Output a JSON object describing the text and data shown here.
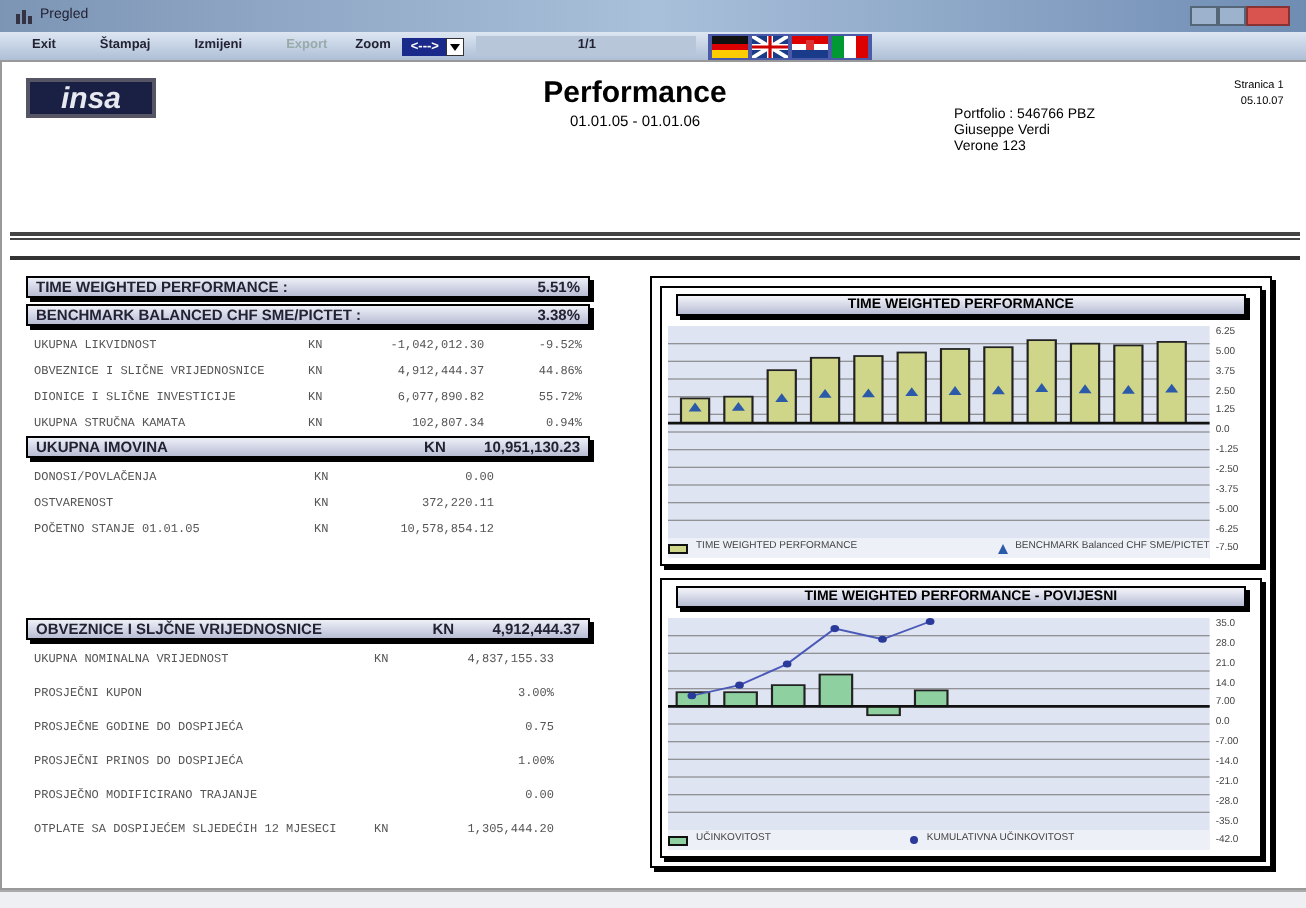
{
  "window": {
    "title": "Pregled"
  },
  "toolbar": {
    "buttons": [
      {
        "label": "Exit",
        "disabled": false
      },
      {
        "label": "Štampaj",
        "disabled": false
      },
      {
        "label": "Izmijeni",
        "disabled": false
      },
      {
        "label": "Export",
        "disabled": true
      }
    ],
    "zoom_label": "Zoom",
    "zoom_value": "<--->",
    "page": "1/1",
    "flags": [
      {
        "kind": "de"
      },
      {
        "kind": "gb"
      },
      {
        "kind": "hr"
      },
      {
        "kind": "it"
      }
    ]
  },
  "header": {
    "logo": "insa",
    "title": "Performance",
    "period": "01.01.05 - 01.01.06",
    "portfolio": [
      "Portfolio : 546766 PBZ",
      "Giuseppe Verdi",
      "Verone 123"
    ],
    "page": "Stranica 1",
    "date": "05.10.07"
  },
  "summary": [
    {
      "label": "TIME WEIGHTED PERFORMANCE :",
      "value": "5.51%"
    },
    {
      "label": "BENCHMARK BALANCED CHF SME/PICTET :",
      "value": "3.38%"
    }
  ],
  "assets": [
    {
      "name": "UKUPNA LIKVIDNOST",
      "unit": "KN",
      "amount": "-1,042,012.30",
      "share": "-9.52%"
    },
    {
      "name": "OBVEZNICE I SLIČNE VRIJEDNOSNICE",
      "unit": "KN",
      "amount": "4,912,444.37",
      "share": "44.86%"
    },
    {
      "name": "DIONICE I SLIČNE INVESTICIJE",
      "unit": "KN",
      "amount": "6,077,890.82",
      "share": "55.72%"
    },
    {
      "name": "UKUPNA STRUČNA KAMATA",
      "unit": "KN",
      "amount": "102,807.34",
      "share": "0.94%"
    }
  ],
  "total": {
    "label": "UKUPNA IMOVINA",
    "unit": "KN",
    "value": "10,951,130.23"
  },
  "flows": [
    {
      "name": "DONOSI/POVLAČENJA",
      "unit": "KN",
      "amount": "0.00"
    },
    {
      "name": "OSTVARENOST",
      "unit": "KN",
      "amount": "372,220.11"
    },
    {
      "name": "POČETNO STANJE  01.01.05",
      "unit": "KN",
      "amount": "10,578,854.12"
    }
  ],
  "bonds": {
    "label": "OBVEZNICE I SLJČNE VRIJEDNOSNICE",
    "unit": "KN",
    "value": "4,912,444.37",
    "rows": [
      {
        "name": "UKUPNA NOMINALNA VRIJEDNOST",
        "unit": "KN",
        "value": "4,837,155.33"
      },
      {
        "name": "PROSJEČNI KUPON",
        "value": "3.00%"
      },
      {
        "name": "PROSJEČNE GODINE DO DOSPIJEĆA",
        "value": "0.75"
      },
      {
        "name": "PROSJEČNI PRINOS DO DOSPIJEĆA",
        "value": "1.00%"
      },
      {
        "name": "PROSJEČNO MODIFICIRANO TRAJANJE",
        "value": "0.00"
      },
      {
        "name": "OTPLATE SA DOSPIJEĆEM SLJEDEĆIH 12 MJESECI",
        "unit": "KN",
        "value": "1,305,444.20"
      }
    ]
  },
  "charts": [
    {
      "kind": "bars",
      "title": "TIME WEIGHTED PERFORMANCE",
      "yticks": [
        "6.25",
        "5.00",
        "3.75",
        "2.50",
        "1.25",
        "0.0",
        "-1.25",
        "-2.50",
        "-3.75",
        "-5.00",
        "-6.25",
        "-7.50"
      ],
      "legend": [
        "TIME WEIGHTED PERFORMANCE",
        "BENCHMARK Balanced CHF SME/PICTET"
      ]
    },
    {
      "kind": "yearly",
      "title": "TIME WEIGHTED PERFORMANCE - POVIJESNI",
      "yticks": [
        "35.0",
        "28.0",
        "21.0",
        "14.0",
        "7.00",
        "0.0",
        "-7.00",
        "-14.0",
        "-21.0",
        "-28.0",
        "-35.0",
        "-42.0"
      ],
      "legend": [
        "UČINKOVITOST",
        "KUMULATIVNA UČINKOVITOST"
      ]
    }
  ]
}
